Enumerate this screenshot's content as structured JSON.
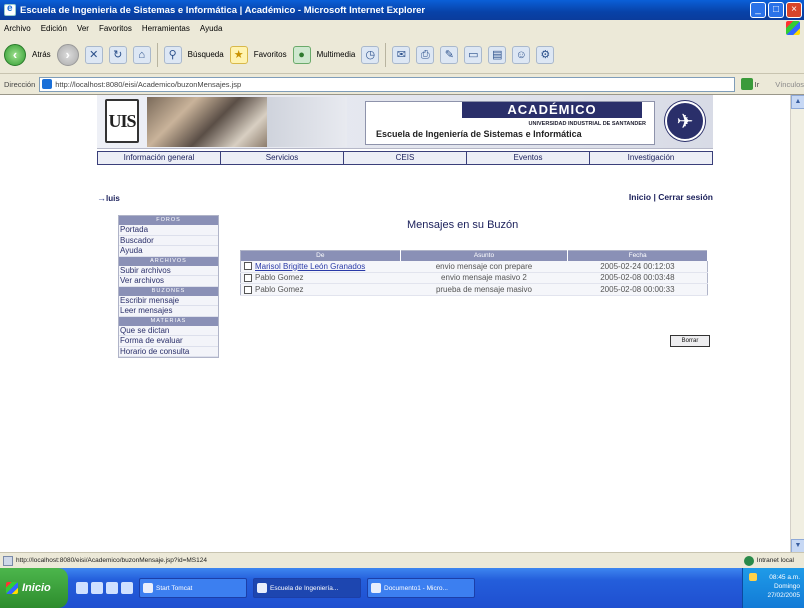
{
  "window": {
    "title": "Escuela de Ingenieria de Sistemas e Informática | Académico - Microsoft Internet Explorer",
    "controls": [
      "_",
      "□",
      "×"
    ]
  },
  "menubar": [
    "Archivo",
    "Edición",
    "Ver",
    "Favoritos",
    "Herramientas",
    "Ayuda"
  ],
  "toolbar": {
    "back_label": "Atrás",
    "search_label": "Búsqueda",
    "favorites_label": "Favoritos",
    "media_label": "Multimedia"
  },
  "addressbar": {
    "label": "Dirección",
    "url": "http://localhost:8080/eisi/Academico/buzonMensajes.jsp",
    "go_label": "Ir",
    "links_label": "Vínculos"
  },
  "banner": {
    "logo_text": "UIS",
    "acad_title": "ACADÉMICO",
    "university": "UNIVERSIDAD INDUSTRIAL DE SANTANDER",
    "school": "Escuela de Ingeniería de Sistemas e Informática"
  },
  "nav": [
    "Información general",
    "Servicios",
    "CEIS",
    "Eventos",
    "Investigación"
  ],
  "user": {
    "name": "luis",
    "links": "Inicio | Cerrar sesión"
  },
  "sidebar": {
    "sections": [
      {
        "header": "FOROS",
        "items": [
          "Portada",
          "Buscador",
          "Ayuda"
        ]
      },
      {
        "header": "ARCHIVOS",
        "items": [
          "Subir archivos",
          "Ver archivos"
        ]
      },
      {
        "header": "BUZONES",
        "items": [
          "Escribir mensaje",
          "Leer mensajes"
        ]
      },
      {
        "header": "MATERIAS",
        "items": [
          "Que se dictan",
          "Forma de evaluar",
          "Horario de consulta"
        ]
      }
    ]
  },
  "main": {
    "title": "Mensajes en su Buzón",
    "columns": [
      "De",
      "Asunto",
      "Fecha"
    ],
    "rows": [
      {
        "from": "Marisol Brigitte León Granados",
        "subject": "envio mensaje con prepare",
        "date": "2005-02-24 00:12:03",
        "link": true
      },
      {
        "from": "Pablo Gomez",
        "subject": "envio mensaje masivo 2",
        "date": "2005-02-08 00:03:48",
        "link": false
      },
      {
        "from": "Pablo Gomez",
        "subject": "prueba de mensaje masivo",
        "date": "2005-02-08 00:00:33",
        "link": false
      }
    ],
    "delete_label": "Borrar"
  },
  "statusbar": {
    "url": "http://localhost:8080/eisi/Academico/buzonMensaje.jsp?id=MS124",
    "zone": "Intranet local"
  },
  "taskbar": {
    "start": "Inicio",
    "tasks": [
      "Start Tomcat",
      "Escuela de Ingeniería...",
      "Documento1 - Micro..."
    ],
    "time": "08:45 a.m.",
    "day": "Domingo",
    "date": "27/02/2005"
  }
}
